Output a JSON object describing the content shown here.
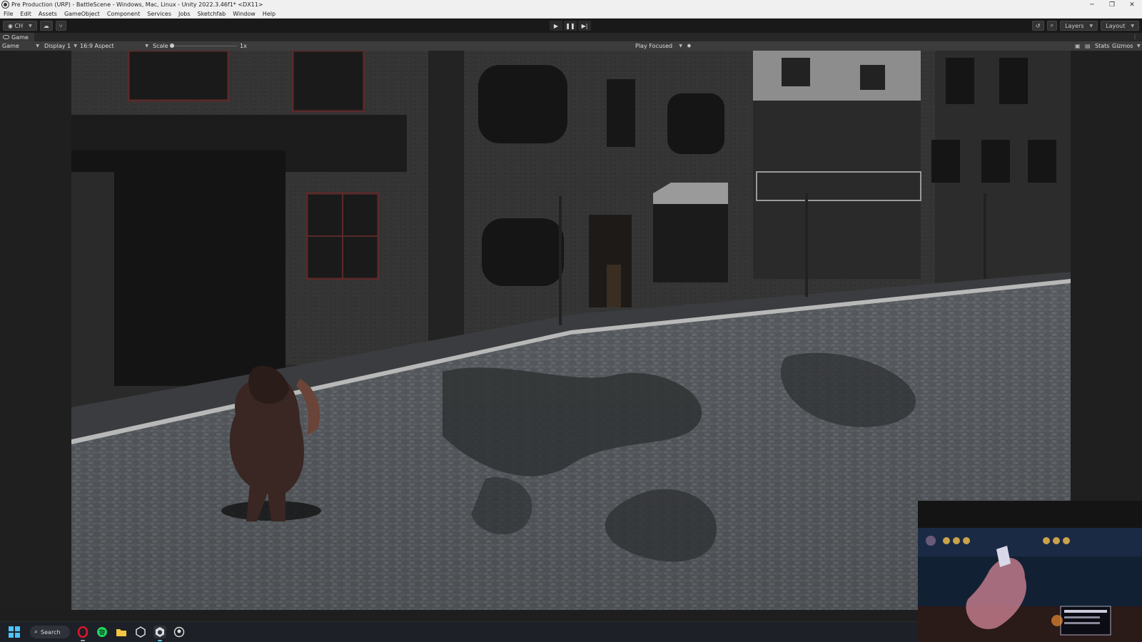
{
  "window": {
    "title": "Pre Production (URP) - BattleScene - Windows, Mac, Linux - Unity 2022.3.46f1* <DX11>",
    "controls": {
      "minimize": "─",
      "restore": "❐",
      "close": "✕"
    }
  },
  "menu": [
    "File",
    "Edit",
    "Assets",
    "GameObject",
    "Component",
    "Services",
    "Jobs",
    "Sketchfab",
    "Window",
    "Help"
  ],
  "toolbar": {
    "account_label": "CH",
    "play_icons": [
      "play-icon",
      "pause-icon",
      "step-icon"
    ],
    "layers_label": "Layers",
    "layout_label": "Layout"
  },
  "game_tab": {
    "label": "Game"
  },
  "game_controls": {
    "view_mode": "Game",
    "display": "Display 1",
    "aspect": "16:9 Aspect",
    "scale_label": "Scale",
    "scale_value": "1x",
    "scale_fraction": 0.0,
    "play_mode": "Play Focused",
    "stats_label": "Stats",
    "gizmos_label": "Gizmos"
  },
  "taskbar": {
    "search_label": "Search",
    "apps": [
      "opera-icon",
      "spotify-icon",
      "file-explorer-icon",
      "unity-hub-icon",
      "unity-icon",
      "github-icon"
    ],
    "colors": {
      "opera": "#e0162b",
      "spotify": "#1ed760",
      "explorer": "#f5c542",
      "accent": "#4cc2ff"
    }
  }
}
